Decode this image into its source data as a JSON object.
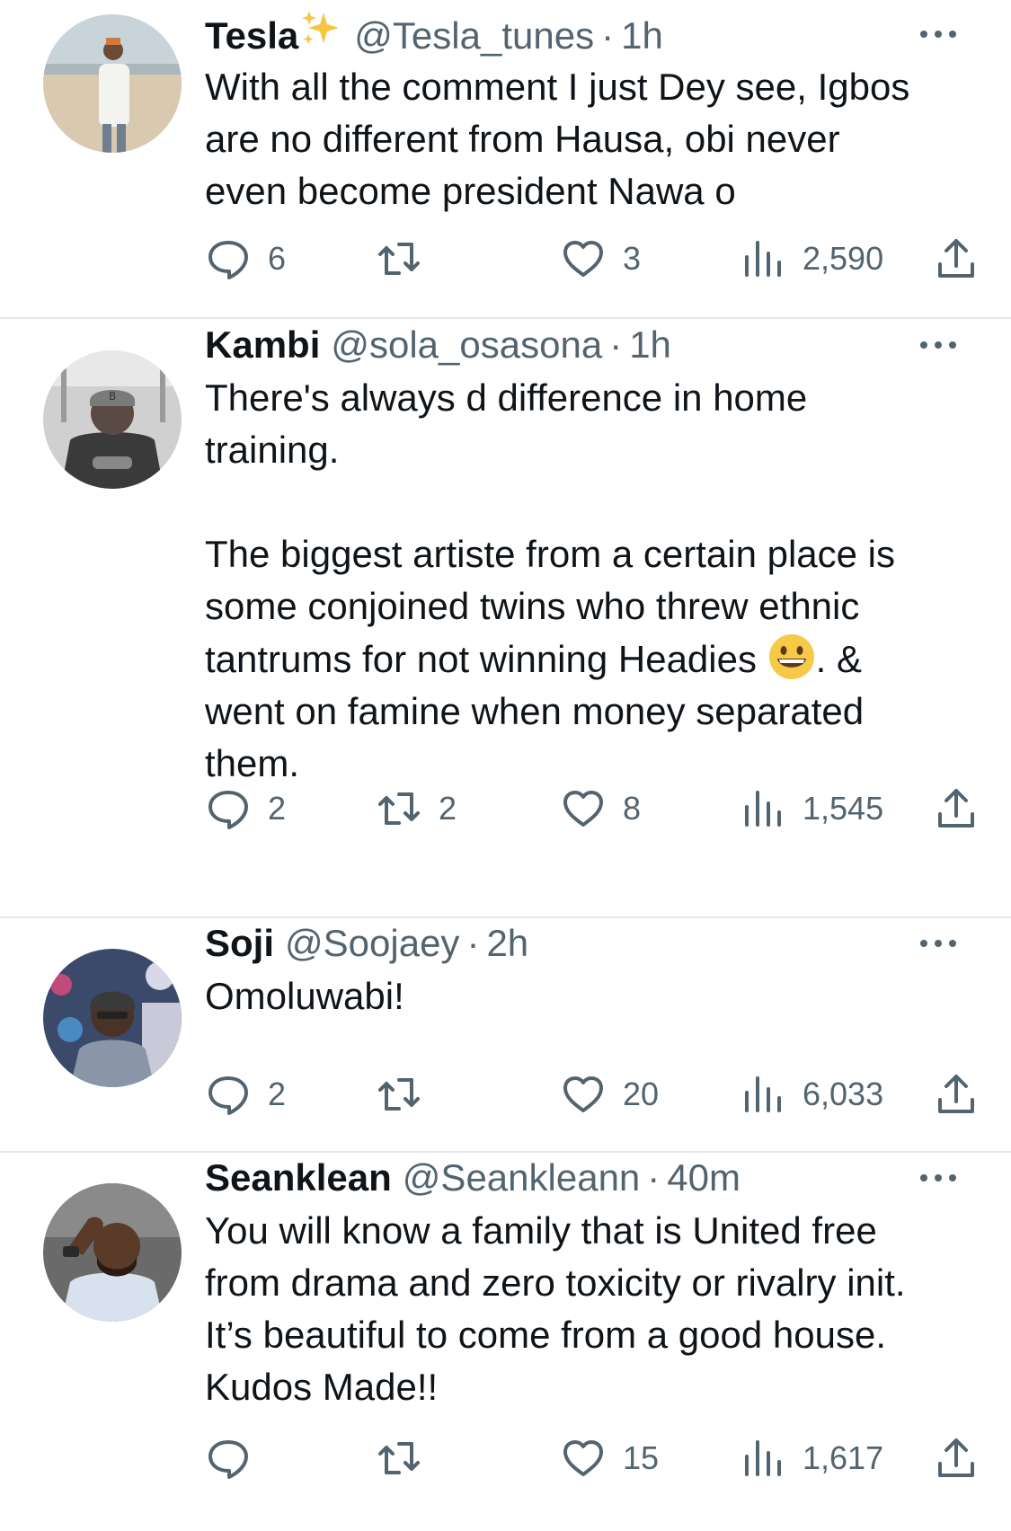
{
  "tweets": [
    {
      "name": "Tesla",
      "has_sparkle": true,
      "handle": "@Tesla_tunes",
      "sep": "·",
      "time": "1h",
      "text": "With all the comment I just Dey see, Igbos are no different from Hausa, obi never even become president Nawa o",
      "replies": "6",
      "retweets": "",
      "likes": "3",
      "views": "2,590"
    },
    {
      "name": "Kambi",
      "has_sparkle": false,
      "handle": "@sola_osasona",
      "sep": "·",
      "time": "1h",
      "text_before_emoji": "There's always d difference in home training.\n\nThe biggest artiste from a certain place is some conjoined twins who threw ethnic tantrums for not winning Headies ",
      "emoji_icon": "grinning-face-emoji",
      "text_after_emoji": ". & went on famine when money separated them.",
      "replies": "2",
      "retweets": "2",
      "likes": "8",
      "views": "1,545"
    },
    {
      "name": "Soji",
      "has_sparkle": false,
      "handle": "@Soojaey",
      "sep": "·",
      "time": "2h",
      "text": "Omoluwabi!",
      "replies": "2",
      "retweets": "",
      "likes": "20",
      "views": "6,033"
    },
    {
      "name": "Seanklean",
      "has_sparkle": false,
      "handle": "@Seankleann",
      "sep": "·",
      "time": "40m",
      "text": "You will know a family that is United free from drama and zero toxicity or rivalry init. It’s beautiful to come from a good house. Kudos Made!!",
      "replies": "",
      "retweets": "",
      "likes": "15",
      "views": "1,617"
    }
  ],
  "icons": {
    "reply": "reply-bubble-icon",
    "retweet": "retweet-icon",
    "like": "heart-icon",
    "views": "views-bar-chart-icon",
    "share": "share-upload-icon",
    "more": "more-dots-icon",
    "sparkle": "sparkles-icon"
  },
  "colors": {
    "text": "#0f1419",
    "secondary": "#536471",
    "divider": "#e3e7ea",
    "sparkle": "#f5c542"
  }
}
